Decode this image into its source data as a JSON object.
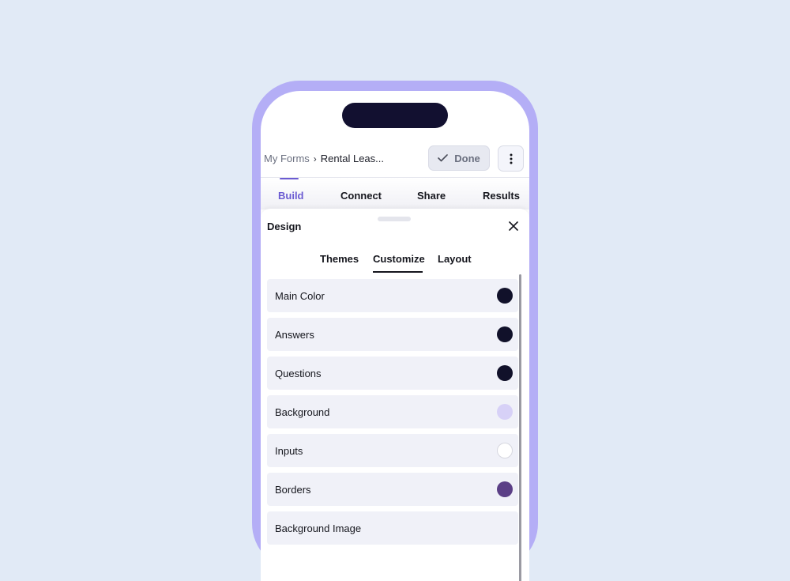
{
  "topbar": {
    "breadcrumb_root": "My Forms",
    "breadcrumb_separator": "›",
    "breadcrumb_current": "Rental Leas...",
    "done_label": "Done"
  },
  "main_tabs": [
    {
      "label": "Build",
      "active": true
    },
    {
      "label": "Connect",
      "active": false
    },
    {
      "label": "Share",
      "active": false
    },
    {
      "label": "Results",
      "active": false
    }
  ],
  "design_panel": {
    "title": "Design",
    "tabs": [
      {
        "label": "Themes",
        "active": false
      },
      {
        "label": "Customize",
        "active": true
      },
      {
        "label": "Layout",
        "active": false
      }
    ],
    "rows": [
      {
        "label": "Main Color",
        "color": "#11112a"
      },
      {
        "label": "Answers",
        "color": "#11112a"
      },
      {
        "label": "Questions",
        "color": "#11112a"
      },
      {
        "label": "Background",
        "color": "#d7d1f7"
      },
      {
        "label": "Inputs",
        "color": "#ffffff"
      },
      {
        "label": "Borders",
        "color": "#5b3f86"
      },
      {
        "label": "Background Image",
        "color": ""
      }
    ]
  },
  "colors": {
    "accent": "#6b5bd2",
    "phone_frame": "#b4aef6",
    "page_background": "#e1eaf6"
  },
  "icons": {
    "done": "check-icon",
    "more": "more-vertical-icon",
    "close": "close-icon"
  }
}
